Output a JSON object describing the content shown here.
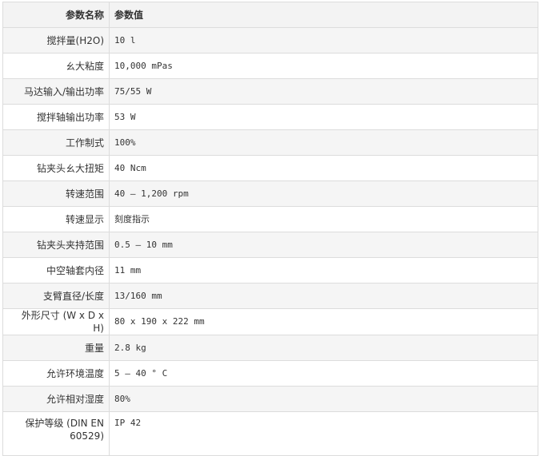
{
  "table": {
    "headers": [
      "参数名称",
      "参数值"
    ],
    "rows": [
      {
        "name": "搅拌量(H2O)",
        "value": "10 l"
      },
      {
        "name": "ㄠ大粘度",
        "value": "10,000 mPas"
      },
      {
        "name": "马达输入/输出功率",
        "value": "75/55 W"
      },
      {
        "name": "搅拌轴输出功率",
        "value": "53 W"
      },
      {
        "name": "工作制式",
        "value": "100%"
      },
      {
        "name": "钻夹头ㄠ大扭矩",
        "value": "40 Ncm"
      },
      {
        "name": "转速范围",
        "value": "40 – 1,200 rpm"
      },
      {
        "name": "转速显示",
        "value": "刻度指示"
      },
      {
        "name": "钻夹头夹持范围",
        "value": "0.5 – 10 mm"
      },
      {
        "name": "中空轴套内径",
        "value": "11 mm"
      },
      {
        "name": "支臂直径/长度",
        "value": "13/160 mm"
      },
      {
        "name": "外形尺寸 (W x D x H)",
        "value": "80 x 190 x 222 mm"
      },
      {
        "name": "重量",
        "value": "2.8 kg"
      },
      {
        "name": "允许环境温度",
        "value": "5 – 40 ° C"
      },
      {
        "name": "允许相对湿度",
        "value": "80%"
      },
      {
        "name": "保护等级 (DIN EN 60529)",
        "value": "IP 42"
      }
    ]
  }
}
